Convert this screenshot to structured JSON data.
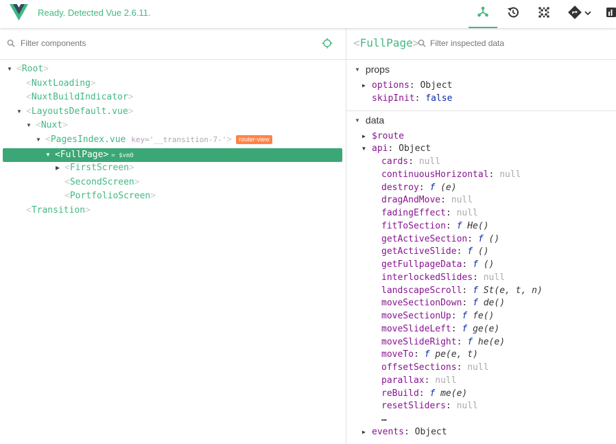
{
  "header": {
    "status": "Ready. Detected Vue 2.6.11.",
    "tabs": [
      {
        "name": "components",
        "icon": "components-icon",
        "active": true
      },
      {
        "name": "timeline",
        "icon": "history-icon"
      },
      {
        "name": "vuex",
        "icon": "vuex-icon"
      },
      {
        "name": "routing",
        "icon": "routing-icon"
      },
      {
        "name": "performance",
        "icon": "performance-icon"
      }
    ],
    "accent": "#41b883"
  },
  "components": {
    "filter_placeholder": "Filter components",
    "tree": [
      {
        "name": "Root"
      },
      {
        "name": "NuxtLoading"
      },
      {
        "name": "NuxtBuildIndicator"
      },
      {
        "name": "LayoutsDefault.vue"
      },
      {
        "name": "Nuxt"
      },
      {
        "name": "PagesIndex.vue",
        "key_label": "key=",
        "key_value": "'__transition-7-'",
        "badge": "router-view"
      },
      {
        "name": "FullPage",
        "vm": "= $vm0",
        "selected": true
      },
      {
        "name": "FirstScreen"
      },
      {
        "name": "SecondScreen"
      },
      {
        "name": "PortfolioScreen"
      },
      {
        "name": "Transition"
      }
    ]
  },
  "inspector": {
    "component": "FullPage",
    "filter_placeholder": "Filter inspected data",
    "props": {
      "title": "props",
      "items": [
        {
          "key": "options",
          "value": "Object"
        },
        {
          "key": "skipInit",
          "value": "false"
        }
      ]
    },
    "data": {
      "title": "data",
      "route_key": "$route",
      "api_key": "api",
      "api_value": "Object",
      "api_items": [
        {
          "key": "cards",
          "value": "null"
        },
        {
          "key": "continuousHorizontal",
          "value": "null"
        },
        {
          "key": "destroy",
          "fn": "f",
          "value": "(e)"
        },
        {
          "key": "dragAndMove",
          "value": "null"
        },
        {
          "key": "fadingEffect",
          "value": "null"
        },
        {
          "key": "fitToSection",
          "fn": "f",
          "value": "He()"
        },
        {
          "key": "getActiveSection",
          "fn": "f",
          "value": "()"
        },
        {
          "key": "getActiveSlide",
          "fn": "f",
          "value": "()"
        },
        {
          "key": "getFullpageData",
          "fn": "f",
          "value": "()"
        },
        {
          "key": "interlockedSlides",
          "value": "null"
        },
        {
          "key": "landscapeScroll",
          "fn": "f",
          "value": "St(e, t, n)"
        },
        {
          "key": "moveSectionDown",
          "fn": "f",
          "value": "de()"
        },
        {
          "key": "moveSectionUp",
          "fn": "f",
          "value": "fe()"
        },
        {
          "key": "moveSlideLeft",
          "fn": "f",
          "value": "ge(e)"
        },
        {
          "key": "moveSlideRight",
          "fn": "f",
          "value": "he(e)"
        },
        {
          "key": "moveTo",
          "fn": "f",
          "value": "pe(e, t)"
        },
        {
          "key": "offsetSections",
          "value": "null"
        },
        {
          "key": "parallax",
          "value": "null"
        },
        {
          "key": "reBuild",
          "fn": "f",
          "value": "me(e)"
        },
        {
          "key": "resetSliders",
          "value": "null"
        }
      ],
      "more": "…",
      "events_key": "events",
      "events_value": "Object"
    }
  }
}
